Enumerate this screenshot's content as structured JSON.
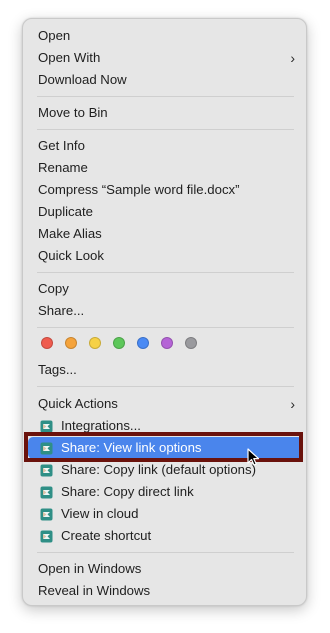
{
  "menu": {
    "group1": [
      {
        "label": "Open"
      },
      {
        "label": "Open With",
        "submenu": true
      },
      {
        "label": "Download Now"
      }
    ],
    "group2": [
      {
        "label": "Move to Bin"
      }
    ],
    "group3": [
      {
        "label": "Get Info"
      },
      {
        "label": "Rename"
      },
      {
        "label": "Compress “Sample word file.docx”"
      },
      {
        "label": "Duplicate"
      },
      {
        "label": "Make Alias"
      },
      {
        "label": "Quick Look"
      }
    ],
    "group4": [
      {
        "label": "Copy"
      },
      {
        "label": "Share..."
      }
    ],
    "tags": {
      "colors": [
        "#ef5b4e",
        "#f5a33b",
        "#f6d145",
        "#5dc75a",
        "#4a8af4",
        "#b564d6",
        "#9a9a9e"
      ],
      "names": [
        "red",
        "orange",
        "yellow",
        "green",
        "blue",
        "purple",
        "gray"
      ],
      "label": "Tags..."
    },
    "group5": [
      {
        "label": "Quick Actions",
        "submenu": true
      },
      {
        "label": "Integrations...",
        "icon": "cloud-app-icon"
      },
      {
        "label": "Share: View link options",
        "icon": "cloud-app-icon",
        "selected": true
      },
      {
        "label": "Share: Copy link (default options)",
        "icon": "cloud-app-icon"
      },
      {
        "label": "Share: Copy direct link",
        "icon": "cloud-app-icon"
      },
      {
        "label": "View in cloud",
        "icon": "cloud-app-icon"
      },
      {
        "label": "Create shortcut",
        "icon": "cloud-app-icon"
      }
    ],
    "group6": [
      {
        "label": "Open in Windows"
      },
      {
        "label": "Reveal in Windows"
      }
    ],
    "colors": {
      "selection": "#4a85ec",
      "highlight_frame": "#6a120c",
      "menu_background": "#e6e6e6"
    }
  }
}
